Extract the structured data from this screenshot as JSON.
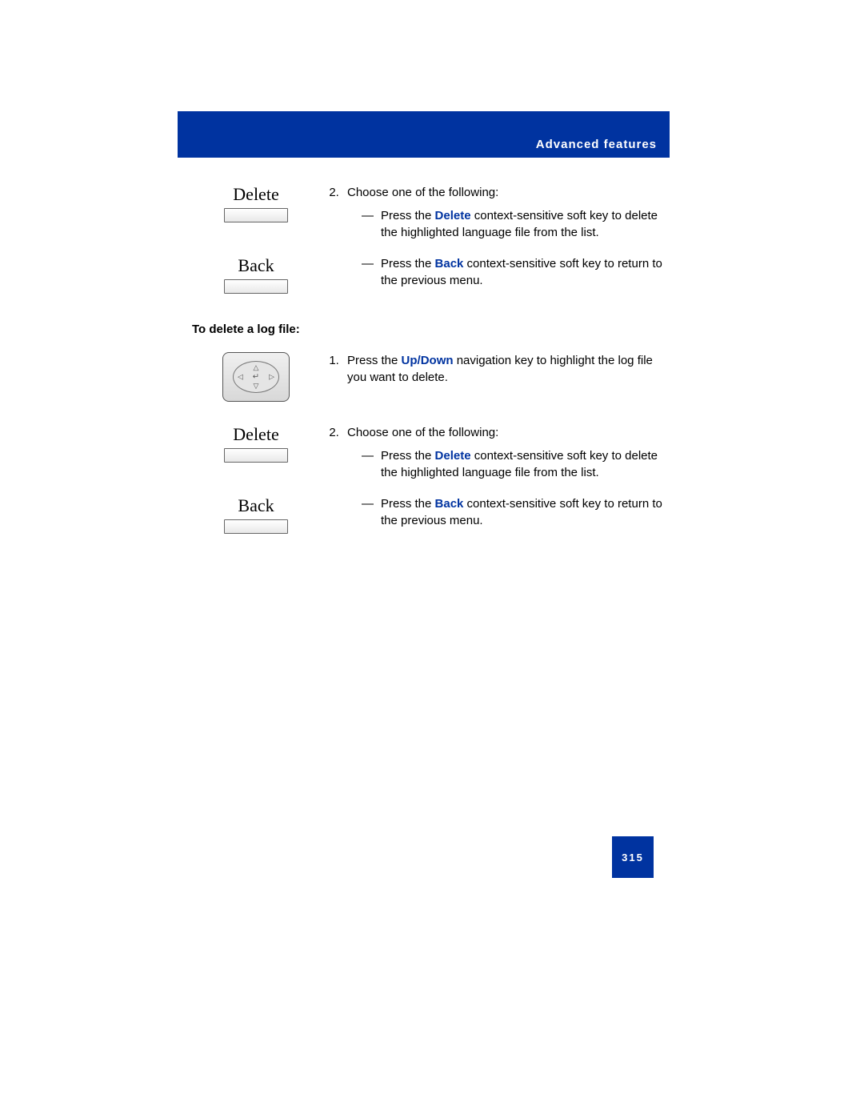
{
  "header": {
    "title": "Advanced features"
  },
  "softkeys": {
    "delete": "Delete",
    "back": "Back"
  },
  "section1": {
    "step2_intro": "Choose one of the following:",
    "bullet1_prefix": "Press the ",
    "bullet1_bold": "Delete",
    "bullet1_suffix": " context-sensitive soft key to delete the highlighted language file from the list.",
    "bullet2_prefix": "Press the ",
    "bullet2_bold": "Back",
    "bullet2_suffix": " context-sensitive soft key to return to the previous menu."
  },
  "section2_heading": "To delete a log file:",
  "section2": {
    "step1_prefix": "Press the ",
    "step1_bold": "Up/Down",
    "step1_suffix": " navigation key to highlight the log file you want to delete.",
    "step2_intro": "Choose one of the following:",
    "bullet1_prefix": "Press the ",
    "bullet1_bold": "Delete",
    "bullet1_suffix": " context-sensitive soft key to delete the highlighted language file from the list.",
    "bullet2_prefix": "Press the ",
    "bullet2_bold": "Back",
    "bullet2_suffix": " context-sensitive soft key to return to the previous menu."
  },
  "page_number": "315"
}
